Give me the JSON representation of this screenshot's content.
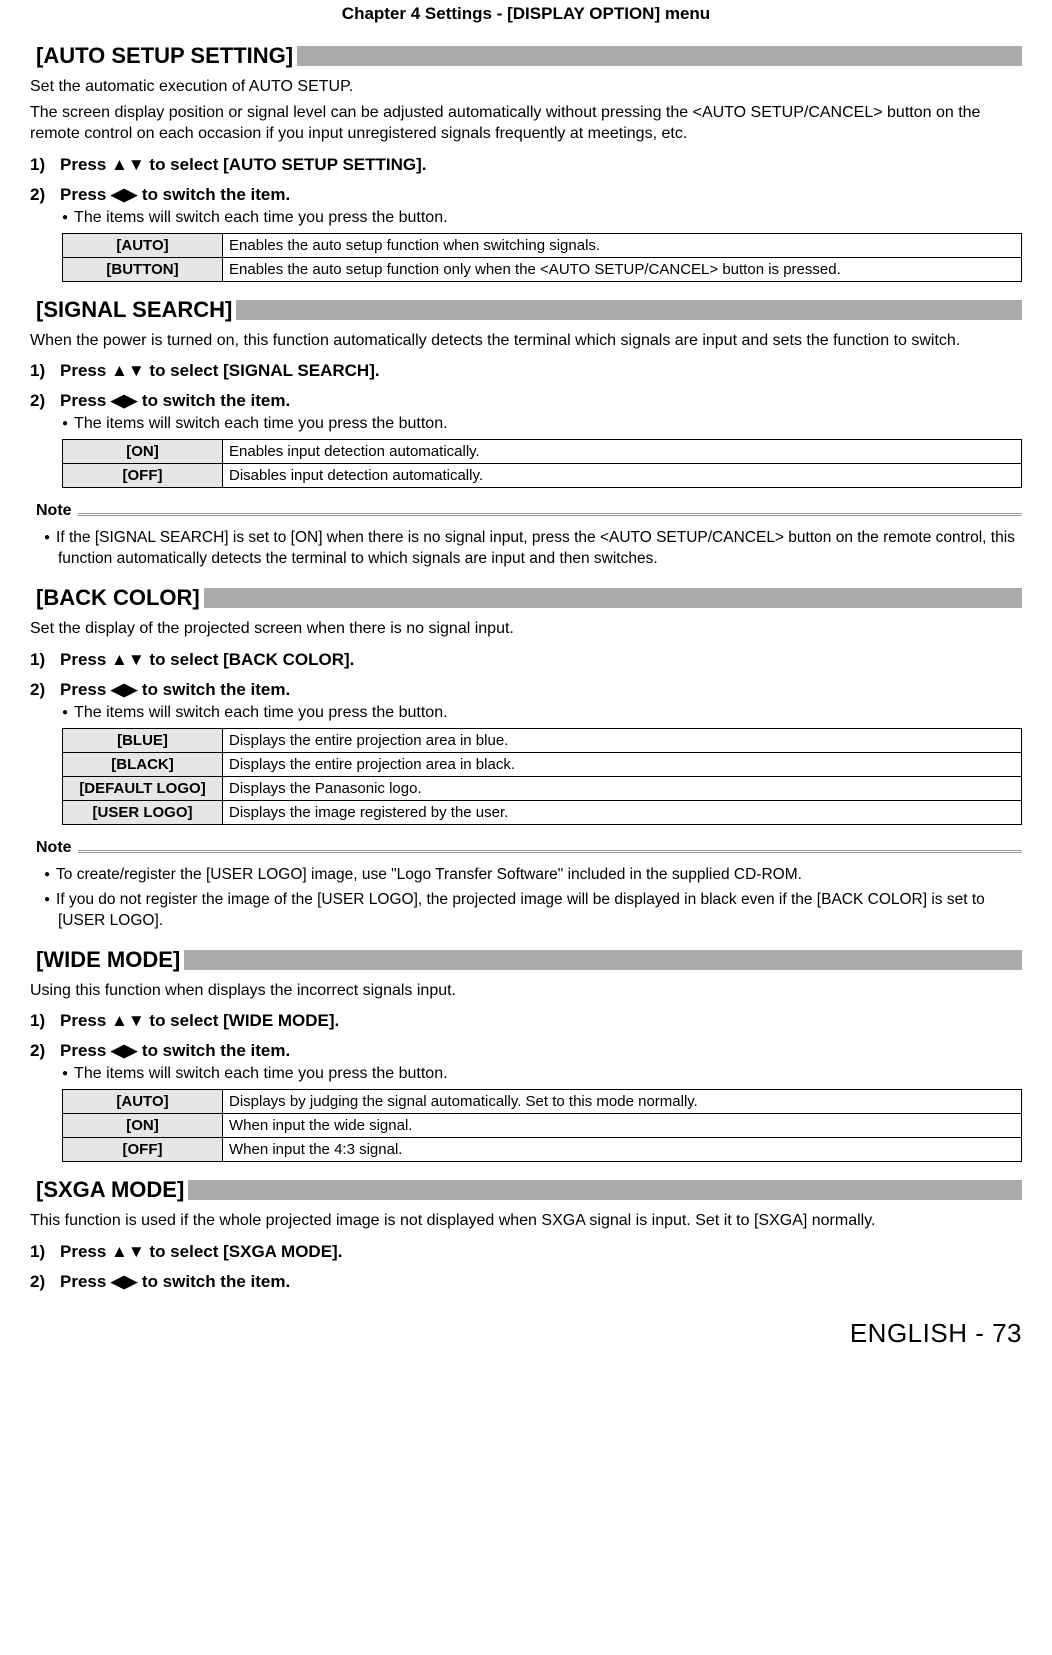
{
  "header": "Chapter 4   Settings - [DISPLAY OPTION] menu",
  "footer": "ENGLISH - 73",
  "note_label": "Note",
  "sections": {
    "auto_setup": {
      "title": "[AUTO SETUP SETTING]",
      "desc1": "Set the automatic execution of AUTO SETUP.",
      "desc2": "The screen display position or signal level can be adjusted automatically without pressing the <AUTO SETUP/CANCEL> button on the remote control on each occasion if you input unregistered signals frequently at meetings, etc.",
      "step1": "Press ▲▼ to select [AUTO SETUP SETTING].",
      "step2": "Press ◀▶ to switch the item.",
      "bullet": "The items will switch each time you press the button.",
      "rows": [
        {
          "k": "[AUTO]",
          "v": "Enables the auto setup function when switching signals."
        },
        {
          "k": "[BUTTON]",
          "v": "Enables the auto setup function only when the <AUTO SETUP/CANCEL> button is pressed."
        }
      ]
    },
    "signal_search": {
      "title": "[SIGNAL SEARCH]",
      "desc": "When the power is turned on, this function automatically detects the terminal which signals are input and sets the function to switch.",
      "step1": "Press ▲▼ to select [SIGNAL SEARCH].",
      "step2": "Press ◀▶ to switch the item.",
      "bullet": "The items will switch each time you press the button.",
      "rows": [
        {
          "k": "[ON]",
          "v": "Enables input detection automatically."
        },
        {
          "k": "[OFF]",
          "v": "Disables input detection automatically."
        }
      ],
      "note": "If the [SIGNAL SEARCH] is set to [ON] when there is no signal input, press the <AUTO SETUP/CANCEL> button on the remote control, this function automatically detects the terminal to which signals are input and then switches."
    },
    "back_color": {
      "title": "[BACK COLOR]",
      "desc": "Set the display of the projected screen when there is no signal input.",
      "step1": "Press ▲▼ to select [BACK COLOR].",
      "step2": "Press ◀▶ to switch the item.",
      "bullet": "The items will switch each time you press the button.",
      "rows": [
        {
          "k": "[BLUE]",
          "v": "Displays the entire projection area in blue."
        },
        {
          "k": "[BLACK]",
          "v": "Displays the entire projection area in black."
        },
        {
          "k": "[DEFAULT LOGO]",
          "v": "Displays the Panasonic logo."
        },
        {
          "k": "[USER LOGO]",
          "v": "Displays the image registered by the user."
        }
      ],
      "note1": "To create/register the [USER LOGO] image, use \"Logo Transfer Software\" included in the supplied CD-ROM.",
      "note2": "If you do not register the image of the [USER LOGO], the projected image will be displayed in black even if the [BACK COLOR] is set to [USER LOGO]."
    },
    "wide_mode": {
      "title": "[WIDE MODE]",
      "desc": "Using this function when displays the incorrect signals input.",
      "step1": "Press ▲▼ to select [WIDE MODE].",
      "step2": "Press ◀▶ to switch the item.",
      "bullet": "The items will switch each time you press the button.",
      "rows": [
        {
          "k": "[AUTO]",
          "v": "Displays by judging the signal automatically. Set to this mode normally."
        },
        {
          "k": "[ON]",
          "v": "When input the wide signal."
        },
        {
          "k": "[OFF]",
          "v": "When input the 4:3 signal."
        }
      ]
    },
    "sxga_mode": {
      "title": "[SXGA MODE]",
      "desc": "This function is used if the whole projected image is not displayed when SXGA signal is input. Set it to [SXGA] normally.",
      "step1": "Press ▲▼ to select [SXGA MODE].",
      "step2": "Press ◀▶ to switch the item."
    }
  }
}
